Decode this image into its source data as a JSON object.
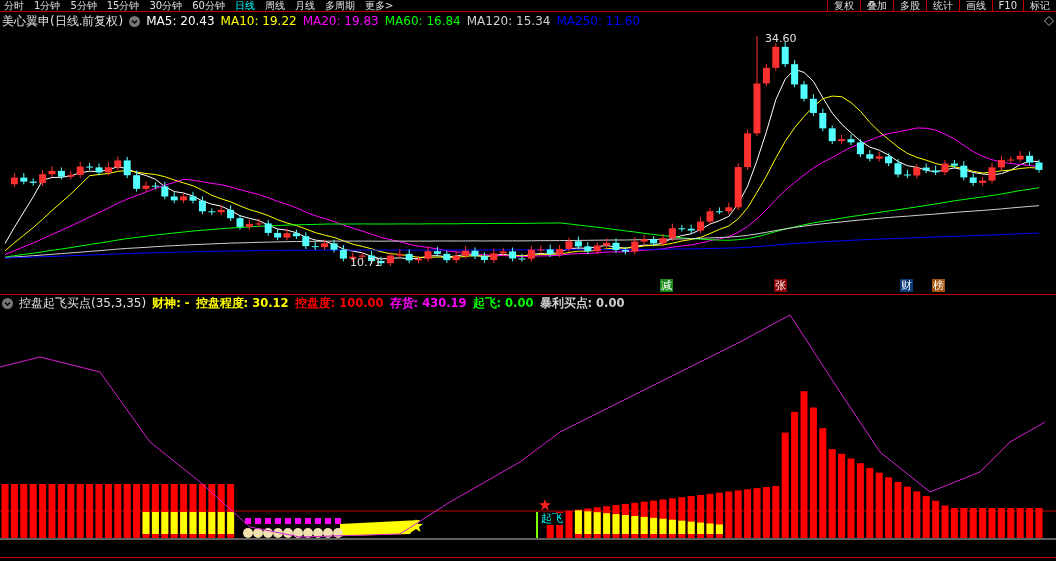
{
  "toolbar": {
    "periods": [
      {
        "label": "分时",
        "selected": false
      },
      {
        "label": "1分钟",
        "selected": false
      },
      {
        "label": "5分钟",
        "selected": false
      },
      {
        "label": "15分钟",
        "selected": false
      },
      {
        "label": "30分钟",
        "selected": false
      },
      {
        "label": "60分钟",
        "selected": false
      },
      {
        "label": "日线",
        "selected": true
      },
      {
        "label": "周线",
        "selected": false
      },
      {
        "label": "月线",
        "selected": false
      },
      {
        "label": "多周期",
        "selected": false
      },
      {
        "label": "更多>",
        "selected": false
      }
    ],
    "buttons": [
      "复权",
      "叠加",
      "多股",
      "统计",
      "画线",
      "F10",
      "标记"
    ]
  },
  "main_chart": {
    "title": "美心翼申(日线.前复权)",
    "indicators": [
      {
        "label": "MA5: 20.43",
        "color": "#ffffff"
      },
      {
        "label": "MA10: 19.22",
        "color": "#ffff00"
      },
      {
        "label": "MA20: 19.83",
        "color": "#ff00ff"
      },
      {
        "label": "MA60: 16.84",
        "color": "#00ff00"
      },
      {
        "label": "MA120: 15.34",
        "color": "#d0d0d0"
      },
      {
        "label": "MA250: 11.60",
        "color": "#0000ff"
      }
    ],
    "high_label": "34.60",
    "low_label": "10.71",
    "signals": [
      {
        "label": "减",
        "color": "#1a8a1a"
      },
      {
        "label": "张",
        "color": "#8b0000"
      },
      {
        "label": "财",
        "color": "#0a3a7a"
      },
      {
        "label": "榜",
        "color": "#a0520a"
      }
    ]
  },
  "indicator_panel": {
    "title": "控盘起飞买点(35,3,35)",
    "readouts": [
      {
        "label": "财神: -",
        "color": "#ffff00"
      },
      {
        "label": "控盘程度: 30.12",
        "color": "#ffff00"
      },
      {
        "label": "控盘度: 100.00",
        "color": "#ff0000"
      },
      {
        "label": "存货: 430.19",
        "color": "#ff00ff"
      },
      {
        "label": "起飞: 0.00",
        "color": "#00ff00"
      },
      {
        "label": "暴利买点: 0.00",
        "color": "#d0d0d0"
      }
    ],
    "marker_label": "起飞"
  }
}
